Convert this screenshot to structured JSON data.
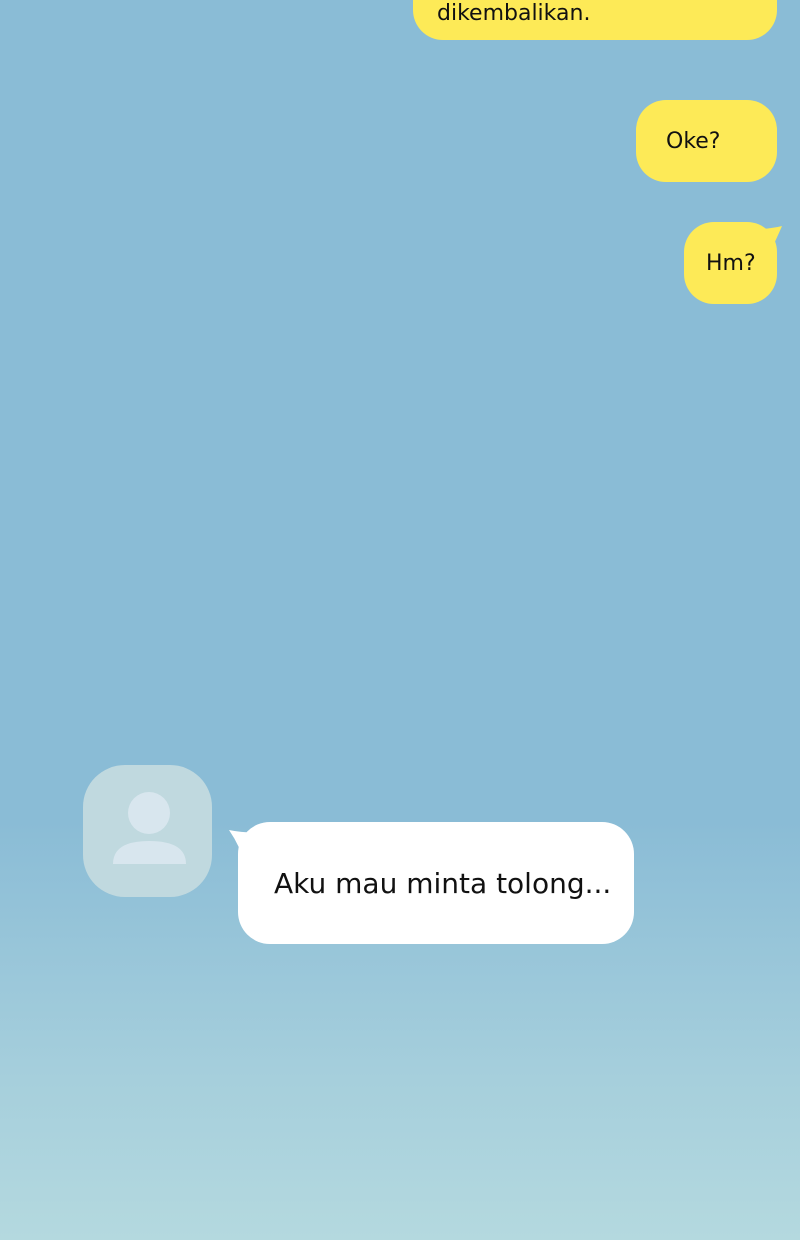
{
  "messages": [
    {
      "id": "msg1",
      "side": "outgoing",
      "text": "dikembalikan."
    },
    {
      "id": "msg2",
      "side": "outgoing",
      "text": "Oke?"
    },
    {
      "id": "msg3",
      "side": "outgoing",
      "text": "Hm?"
    },
    {
      "id": "msg4",
      "side": "incoming",
      "text": "Aku mau minta tolong..."
    }
  ],
  "contact": {
    "avatar_icon": "default-user-icon"
  },
  "colors": {
    "background_top": "#8abcd6",
    "background_bottom": "#b4d9df",
    "outgoing_bubble": "#fdea57",
    "incoming_bubble": "#ffffff",
    "avatar_bg": "#c0d9df",
    "avatar_figure": "#d8e6ee"
  }
}
